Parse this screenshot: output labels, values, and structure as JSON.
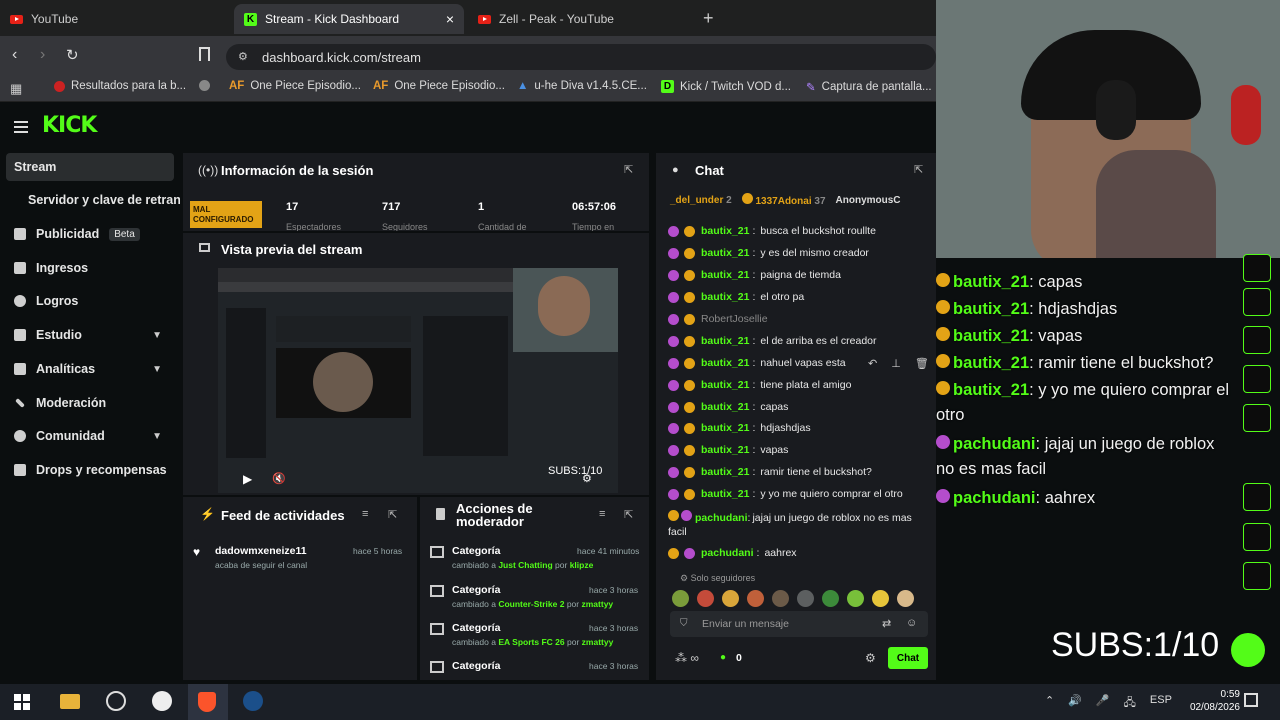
{
  "tabs": [
    {
      "label": "YouTube"
    },
    {
      "label": "Stream - Kick Dashboard"
    },
    {
      "label": "Zell - Peak - YouTube"
    }
  ],
  "url": "dashboard.kick.com/stream",
  "bookmarks": [
    "Resultados para la b...",
    "One Piece Episodio...",
    "One Piece Episodio...",
    "u-he Diva v1.4.5.CE...",
    "Kick / Twitch VOD d...",
    "Captura de pantalla..."
  ],
  "brand": "KICK",
  "sidebar": {
    "items": [
      {
        "label": "Stream"
      },
      {
        "label": "Servidor y clave de retransn"
      },
      {
        "label": "Publicidad",
        "badge": "Beta"
      },
      {
        "label": "Ingresos"
      },
      {
        "label": "Logros"
      },
      {
        "label": "Estudio"
      },
      {
        "label": "Analíticas"
      },
      {
        "label": "Moderación"
      },
      {
        "label": "Comunidad"
      },
      {
        "label": "Drops y recompensas"
      }
    ]
  },
  "session": {
    "title": "Información de la sesión",
    "status": "MAL CONFIGURADO",
    "stats": [
      {
        "value": "17",
        "label": "Espectadores"
      },
      {
        "value": "717",
        "label": "Seguidores"
      },
      {
        "value": "1",
        "label": "Cantidad de"
      },
      {
        "value": "06:57:06",
        "label": "Tiempo en"
      }
    ]
  },
  "preview": {
    "title": "Vista previa del stream",
    "subs": "SUBS:1/10"
  },
  "feed": {
    "title": "Feed de actividades",
    "items": [
      {
        "user": "dadowmxeneize11",
        "time": "hace 5 horas",
        "text": "acaba de seguir el canal"
      }
    ]
  },
  "modactions": {
    "title": "Acciones de moderador",
    "items": [
      {
        "title": "Categoría",
        "time": "hace 41 minutos",
        "prefix": "cambiado a",
        "cat": "Just Chatting",
        "by": "por",
        "user": "klipze"
      },
      {
        "title": "Categoría",
        "time": "hace 3 horas",
        "prefix": "cambiado a",
        "cat": "Counter-Strike 2",
        "by": "por",
        "user": "zmattyy"
      },
      {
        "title": "Categoría",
        "time": "hace 3 horas",
        "prefix": "cambiado a",
        "cat": "EA Sports FC 26",
        "by": "por",
        "user": "zmattyy"
      },
      {
        "title": "Categoría",
        "time": "hace 3 horas"
      }
    ]
  },
  "chat": {
    "title": "Chat",
    "leaders": [
      {
        "name": "_del_under",
        "n": "2"
      },
      {
        "name": "1337Adonai",
        "n": "37"
      },
      {
        "name": "AnonymousC"
      }
    ],
    "messages": [
      {
        "user": "bautix_21",
        "text": "busca el buckshot roullte"
      },
      {
        "user": "bautix_21",
        "text": "y es del mismo creador"
      },
      {
        "user": "bautix_21",
        "text": "paigna de tiemda"
      },
      {
        "user": "bautix_21",
        "text": "el otro pa"
      },
      {
        "user": "RobertJosellie",
        "text": ""
      },
      {
        "user": "bautix_21",
        "text": "el de arriba es el creador"
      },
      {
        "user": "bautix_21",
        "text": "nahuel vapas esta"
      },
      {
        "user": "bautix_21",
        "text": "tiene plata el amigo"
      },
      {
        "user": "bautix_21",
        "text": "capas"
      },
      {
        "user": "bautix_21",
        "text": "hdjashdjas"
      },
      {
        "user": "bautix_21",
        "text": "vapas"
      },
      {
        "user": "bautix_21",
        "text": "ramir tiene el buckshot?"
      },
      {
        "user": "bautix_21",
        "text": "y yo me quiero comprar el otro"
      },
      {
        "user": "pachudani",
        "text": "jajaj un juego de roblox no es mas facil"
      },
      {
        "user": "pachudani",
        "text": "aahrex"
      }
    ],
    "followers_only": "Solo seguidores",
    "placeholder": "Enviar un mensaje",
    "points": "0",
    "send": "Chat"
  },
  "overlay": {
    "messages": [
      {
        "user": "bautix_21",
        "text": "capas"
      },
      {
        "user": "bautix_21",
        "text": "hdjashdjas"
      },
      {
        "user": "bautix_21",
        "text": "vapas"
      },
      {
        "user": "bautix_21",
        "text": "ramir tiene el buckshot?"
      },
      {
        "user": "bautix_21",
        "text": "y yo me quiero comprar el",
        "cont": "otro"
      },
      {
        "user": "pachudani",
        "text": "jajaj un juego de roblox",
        "cont": "no es mas facil"
      },
      {
        "user": "pachudani",
        "text": "aahrex"
      }
    ],
    "subs": "SUBS:1/10"
  },
  "taskbar": {
    "lang": "ESP",
    "time": "0:59",
    "date": "02/08/2026"
  },
  "colors": {
    "accent": "#53fc18",
    "bg": "#0b0e0f",
    "panel": "#191b1f"
  }
}
